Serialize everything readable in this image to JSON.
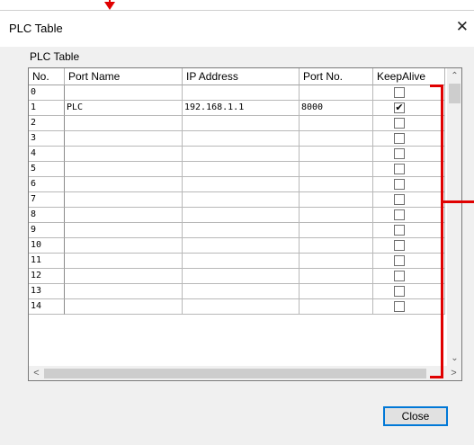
{
  "dialog": {
    "title": "PLC Table",
    "close_glyph": "✕",
    "group_label": "PLC Table"
  },
  "table": {
    "columns": [
      "No.",
      "Port Name",
      "IP Address",
      "Port No.",
      "KeepAlive"
    ],
    "rows": [
      {
        "no": "0",
        "port_name": "",
        "ip": "",
        "port": "",
        "keepalive": false
      },
      {
        "no": "1",
        "port_name": "PLC",
        "ip": "192.168.1.1",
        "port": "8000",
        "keepalive": true
      },
      {
        "no": "2",
        "port_name": "",
        "ip": "",
        "port": "",
        "keepalive": false
      },
      {
        "no": "3",
        "port_name": "",
        "ip": "",
        "port": "",
        "keepalive": false
      },
      {
        "no": "4",
        "port_name": "",
        "ip": "",
        "port": "",
        "keepalive": false
      },
      {
        "no": "5",
        "port_name": "",
        "ip": "",
        "port": "",
        "keepalive": false
      },
      {
        "no": "6",
        "port_name": "",
        "ip": "",
        "port": "",
        "keepalive": false
      },
      {
        "no": "7",
        "port_name": "",
        "ip": "",
        "port": "",
        "keepalive": false
      },
      {
        "no": "8",
        "port_name": "",
        "ip": "",
        "port": "",
        "keepalive": false
      },
      {
        "no": "9",
        "port_name": "",
        "ip": "",
        "port": "",
        "keepalive": false
      },
      {
        "no": "10",
        "port_name": "",
        "ip": "",
        "port": "",
        "keepalive": false
      },
      {
        "no": "11",
        "port_name": "",
        "ip": "",
        "port": "",
        "keepalive": false
      },
      {
        "no": "12",
        "port_name": "",
        "ip": "",
        "port": "",
        "keepalive": false
      },
      {
        "no": "13",
        "port_name": "",
        "ip": "",
        "port": "",
        "keepalive": false
      },
      {
        "no": "14",
        "port_name": "",
        "ip": "",
        "port": "",
        "keepalive": false
      }
    ]
  },
  "scrollbar": {
    "up": "⌃",
    "down": "⌄",
    "left": "<",
    "right": ">"
  },
  "buttons": {
    "close_label": "Close"
  },
  "colors": {
    "annotation": "#e00000",
    "focus_border": "#0078d7"
  },
  "icons": {
    "title_close": "close-icon",
    "checkbox": "checkbox-icon",
    "scroll_up": "chevron-up-icon",
    "scroll_down": "chevron-down-icon",
    "scroll_left": "chevron-left-icon",
    "scroll_right": "chevron-right-icon"
  }
}
